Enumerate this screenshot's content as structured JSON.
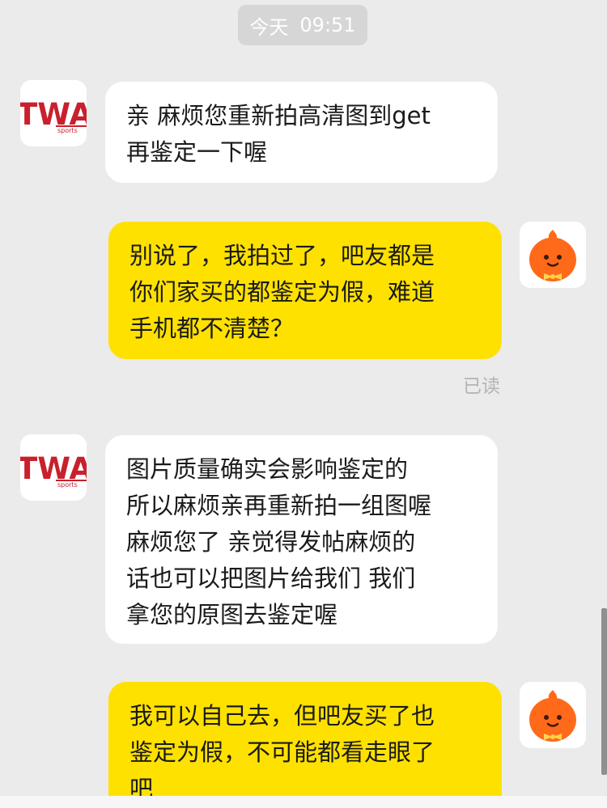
{
  "timestamp": {
    "day": "今天",
    "time": "09:51"
  },
  "merchant_avatar": {
    "logo_text": "TWA",
    "logo_subtext": "sports"
  },
  "messages": [
    {
      "side": "in",
      "lines": [
        "亲 麻烦您重新拍高清图到get",
        "再鉴定一下喔"
      ]
    },
    {
      "side": "out",
      "lines": [
        "别说了，我拍过了，吧友都是",
        "你们家买的都鉴定为假，难道",
        "手机都不清楚？"
      ]
    },
    {
      "side": "in",
      "lines": [
        "图片质量确实会影响鉴定的",
        "所以麻烦亲再重新拍一组图喔",
        "麻烦您了 亲觉得发帖麻烦的",
        "话也可以把图片给我们 我们",
        "拿您的原图去鉴定喔"
      ]
    },
    {
      "side": "out",
      "lines": [
        "我可以自己去，但吧友买了也",
        "鉴定为假，不可能都看走眼了",
        "吧"
      ]
    }
  ],
  "read_status": "已读",
  "colors": {
    "background": "#ebebeb",
    "incoming_bubble": "#ffffff",
    "outgoing_bubble": "#ffe100",
    "logo_red": "#c8202d",
    "mascot_orange": "#ff6a1a",
    "bowtie_yellow": "#ffd54a"
  },
  "icons": [
    "twa-sports-logo",
    "orange-mascot-avatar"
  ]
}
